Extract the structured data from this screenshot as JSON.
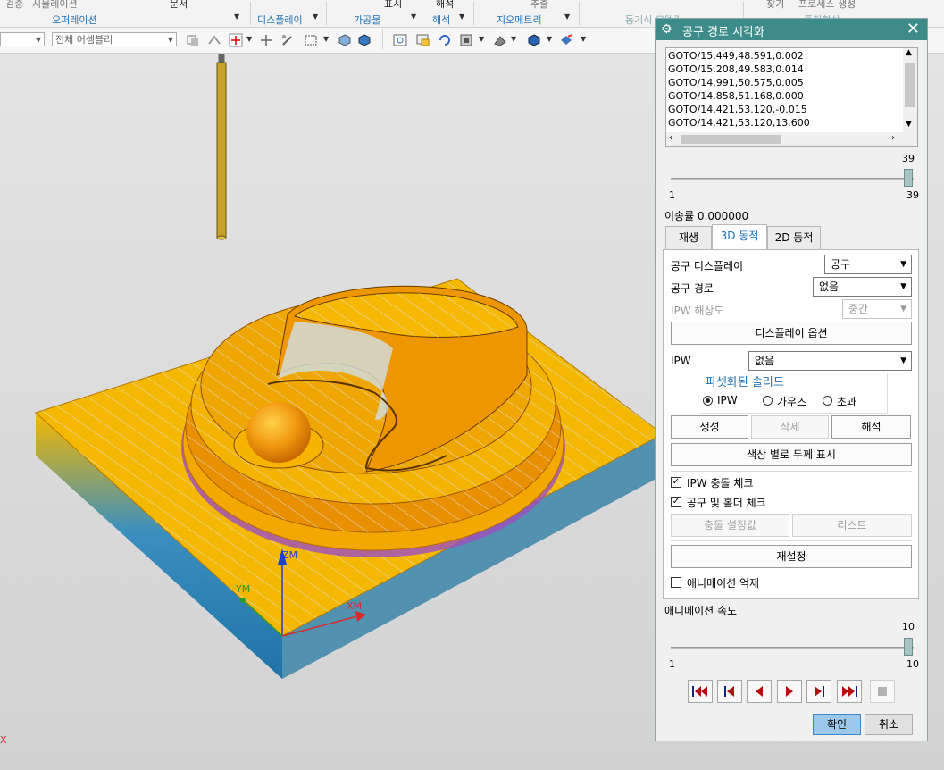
{
  "ribbon": {
    "cut_labels": [
      "검증",
      "시뮬레이션",
      "문서",
      "표시",
      "해석",
      "추출",
      "찾기",
      "프로세스 생성"
    ],
    "groups": [
      "오퍼레이션",
      "디스플레이",
      "가공물",
      "해석",
      "지오메트리",
      "동기식 모델링",
      "특징형상"
    ]
  },
  "toolbar": {
    "combo1": "",
    "combo2": "전체 어셈블리"
  },
  "viewport": {
    "axis_z": "ZM",
    "axis_y": "YM",
    "axis_x": "XM",
    "corner_mark": "X"
  },
  "dialog": {
    "title": "공구 경로 시각화",
    "path_lines": [
      "GOTO/15.449,48.591,0.002",
      "GOTO/15.208,49.583,0.014",
      "GOTO/14.991,50.575,0.005",
      "GOTO/14.858,51.168,0.000",
      "GOTO/14.421,53.120,-0.015",
      "GOTO/14.421,53.120,13.600"
    ],
    "slider1": {
      "value": 39,
      "min": "1",
      "max": "39",
      "value_label": "39"
    },
    "feed_rate": "이송률 0.000000",
    "tabs": [
      "재생",
      "3D 동적",
      "2D 동적"
    ],
    "active_tab": "3D 동적",
    "tool_display_label": "공구 디스플레이",
    "tool_display_value": "공구",
    "tool_path_label": "공구 경로",
    "tool_path_value": "없음",
    "ipw_res_label": "IPW 해상도",
    "ipw_res_value": "중간",
    "display_options": "디스플레이 옵션",
    "ipw_label": "IPW",
    "ipw_value": "없음",
    "faceted_solid": "파셋화된 솔리드",
    "radio_ipw": "IPW",
    "radio_gouge": "가우즈",
    "radio_excess": "초과",
    "btn_create": "생성",
    "btn_delete": "삭제",
    "btn_analyze": "해석",
    "btn_color_thickness": "색상 별로 두께 표시",
    "chk_ipw_collision": "IPW 충돌 체크",
    "chk_tool_holder": "공구 및 홀더 체크",
    "btn_collision_settings": "충돌 설정값",
    "btn_list": "리스트",
    "btn_reset": "재설정",
    "chk_suppress_anim": "애니메이션 억제",
    "anim_speed_label": "애니메이션 속도",
    "slider2": {
      "value": 10,
      "min": "1",
      "max": "10",
      "value_label": "10"
    },
    "ok": "확인",
    "cancel": "취소"
  },
  "colors": {
    "title_bar": "#3d8c8a",
    "part_yellow": "#f5b800",
    "part_orange": "#e89000",
    "part_blue": "#2d87b5",
    "accent_blue": "#1f6fb5",
    "ok_button": "#9cc9ea"
  }
}
